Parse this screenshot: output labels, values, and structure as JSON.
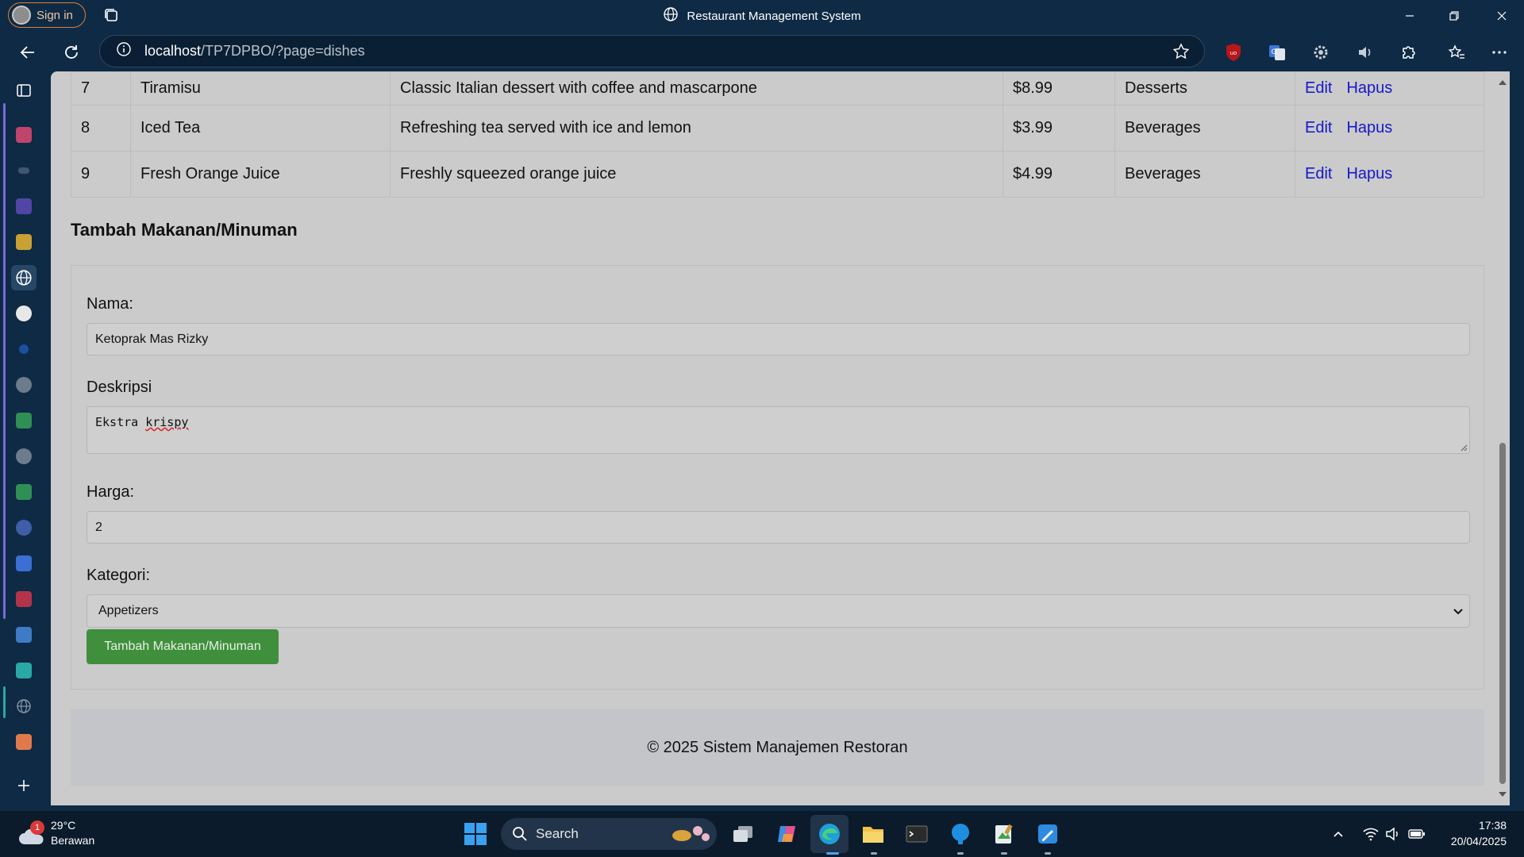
{
  "browser": {
    "sign_in_label": "Sign in",
    "window_title": "Restaurant Management System",
    "url_host": "localhost",
    "url_path": "/TP7DPBO/?page=dishes"
  },
  "table": {
    "rows": [
      {
        "id": "7",
        "name": "Tiramisu",
        "description": "Classic Italian dessert with coffee and mascarpone",
        "price": "$8.99",
        "category": "Desserts",
        "edit": "Edit",
        "delete": "Hapus"
      },
      {
        "id": "8",
        "name": "Iced Tea",
        "description": "Refreshing tea served with ice and lemon",
        "price": "$3.99",
        "category": "Beverages",
        "edit": "Edit",
        "delete": "Hapus"
      },
      {
        "id": "9",
        "name": "Fresh Orange Juice",
        "description": "Freshly squeezed orange juice",
        "price": "$4.99",
        "category": "Beverages",
        "edit": "Edit",
        "delete": "Hapus"
      }
    ]
  },
  "form": {
    "title": "Tambah Makanan/Minuman",
    "name_label": "Nama:",
    "name_value": "Ketoprak Mas Rizky",
    "desc_label": "Deskripsi",
    "desc_word1": "Ekstra",
    "desc_word2": "krispy",
    "price_label": "Harga:",
    "price_value": "2",
    "category_label": "Kategori:",
    "category_value": "Appetizers",
    "submit_label": "Tambah Makanan/Minuman"
  },
  "footer": {
    "text": "© 2025 Sistem Manajemen Restoran"
  },
  "taskbar": {
    "weather_temp": "29°C",
    "weather_condition": "Berawan",
    "weather_badge": "1",
    "search_label": "Search",
    "time": "17:38",
    "date": "20/04/2025"
  },
  "colors": {
    "chrome": "#0e2a45",
    "page_bg": "#cbcbcb",
    "link": "#1717c9",
    "button": "#3f8f3d",
    "taskbar": "#0b1b2b"
  }
}
